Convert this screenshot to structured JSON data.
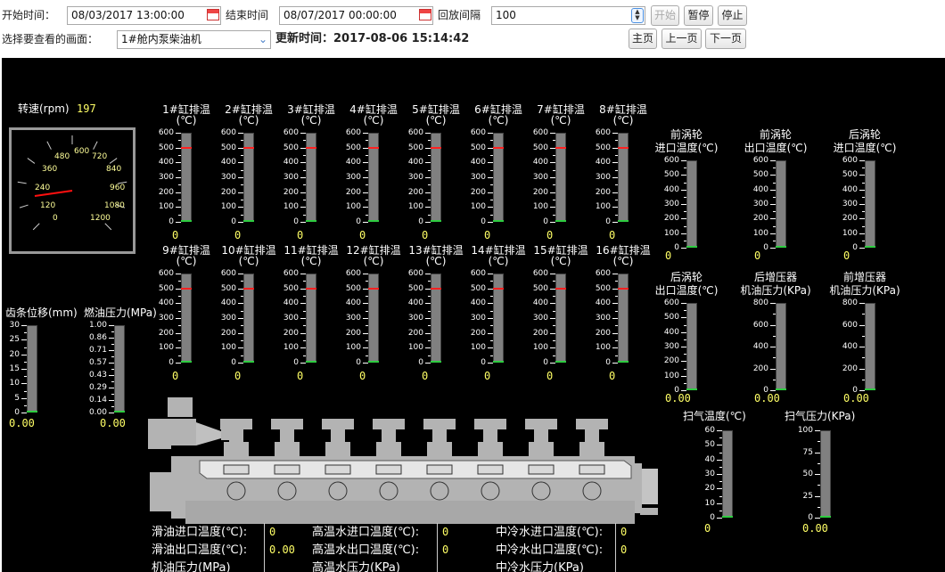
{
  "toolbar": {
    "start_label": "开始时间：",
    "start_value": "08/03/2017 13:00:00",
    "end_label": "结束时间",
    "end_value": "08/07/2017 00:00:00",
    "interval_label": "回放间隔",
    "interval_value": "100",
    "start_btn": "开始",
    "pause_btn": "暂停",
    "stop_btn": "停止",
    "screen_label": "选择要查看的画面：",
    "screen_value": "1#舱内泵柴油机",
    "update_label": "更新时间：2017-08-06 15:14:42",
    "home_btn": "主页",
    "prev_btn": "上一页",
    "next_btn": "下一页"
  },
  "rpm": {
    "label": "转速(rpm)",
    "value": "197",
    "dial_ticks": [
      "120",
      "240",
      "360",
      "480",
      "600",
      "720",
      "840",
      "960",
      "1080",
      "1200",
      "0"
    ]
  },
  "exhaust": {
    "row1": [
      "1#缸排温",
      "2#缸排温",
      "3#缸排温",
      "4#缸排温",
      "5#缸排温",
      "6#缸排温",
      "7#缸排温",
      "8#缸排温"
    ],
    "row2": [
      "9#缸排温",
      "10#缸排温",
      "11#缸排温",
      "12#缸排温",
      "13#缸排温",
      "14#缸排温",
      "15#缸排温",
      "16#缸排温"
    ],
    "unit": "(℃)",
    "ticks": [
      "600",
      "500",
      "400",
      "300",
      "200",
      "100",
      "0"
    ],
    "value": "0",
    "alarm_level": 500,
    "max": 600
  },
  "turbo": {
    "items": [
      {
        "l1": "前涡轮",
        "l2": "进口温度(℃)",
        "ticks": [
          "600",
          "500",
          "400",
          "300",
          "200",
          "100",
          "0"
        ],
        "value": "0"
      },
      {
        "l1": "前涡轮",
        "l2": "出口温度(℃)",
        "ticks": [
          "600",
          "500",
          "400",
          "300",
          "200",
          "100",
          "0"
        ],
        "value": "0"
      },
      {
        "l1": "后涡轮",
        "l2": "进口温度(℃)",
        "ticks": [
          "600",
          "500",
          "400",
          "300",
          "200",
          "100",
          "0"
        ],
        "value": "0"
      },
      {
        "l1": "后涡轮",
        "l2": "出口温度(℃)",
        "ticks": [
          "600",
          "500",
          "400",
          "300",
          "200",
          "100",
          "0"
        ],
        "value": "0.00"
      },
      {
        "l1": "后增压器",
        "l2": "机油压力(KPa)",
        "ticks": [
          "800",
          "600",
          "400",
          "200",
          "0"
        ],
        "value": "0.00"
      },
      {
        "l1": "前增压器",
        "l2": "机油压力(KPa)",
        "ticks": [
          "800",
          "600",
          "400",
          "200",
          "0"
        ],
        "value": "0.00"
      }
    ]
  },
  "scavenge": {
    "temp_label": "扫气温度(℃)",
    "temp_ticks": [
      "60",
      "50",
      "40",
      "30",
      "20",
      "10",
      "0"
    ],
    "temp_value": "0",
    "pres_label": "扫气压力(KPa)",
    "pres_ticks": [
      "100",
      "75",
      "50",
      "25",
      "0"
    ],
    "pres_value": "0.00"
  },
  "rack": {
    "label": "齿条位移(mm)",
    "ticks": [
      "30",
      "25",
      "20",
      "15",
      "10",
      "5",
      "0"
    ],
    "value": "0.00"
  },
  "fuel": {
    "label": "燃油压力(MPa)",
    "ticks": [
      "1.00",
      "0.86",
      "0.71",
      "0.57",
      "0.43",
      "0.29",
      "0.14",
      "0.00"
    ],
    "value": "0.00"
  },
  "table": {
    "c1": [
      "滑油进口温度(℃):",
      "滑油出口温度(℃):",
      "机油压力(MPa)"
    ],
    "v1": [
      "0",
      "0.00",
      ""
    ],
    "c2": [
      "高温水进口温度(℃):",
      "高温水出口温度(℃):",
      "高温水压力(KPa)"
    ],
    "v2": [
      "0",
      "0",
      ""
    ],
    "c3": [
      "中冷水进口温度(℃):",
      "中冷水出口温度(℃):",
      "中冷水压力(KPa)"
    ],
    "v3": [
      "0",
      "0",
      ""
    ]
  }
}
